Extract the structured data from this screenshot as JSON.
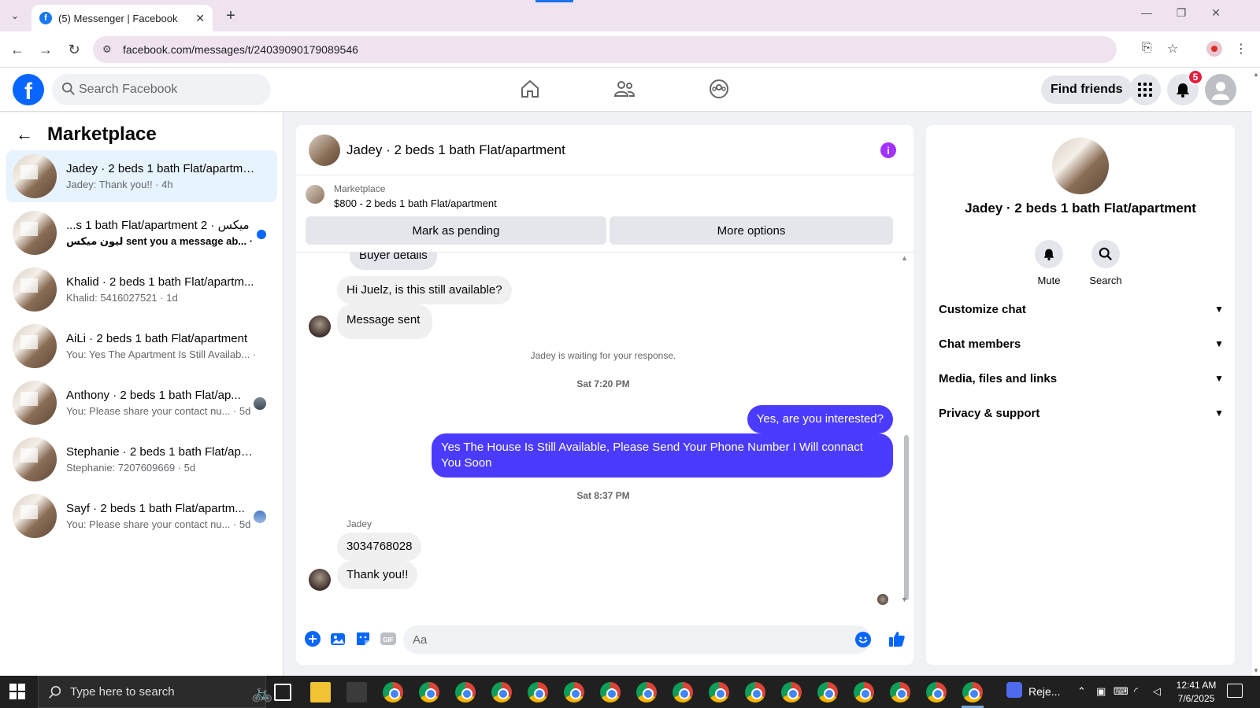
{
  "browser": {
    "tab_title": "(5) Messenger | Facebook",
    "tab_favicon": "f",
    "url": "facebook.com/messages/t/24039090179089546",
    "new_tab_symbol": "+",
    "close_tab_symbol": "✕"
  },
  "fb_header": {
    "logo_letter": "f",
    "search_placeholder": "Search Facebook",
    "find_friends_label": "Find friends",
    "notification_count": "5"
  },
  "sidebar": {
    "title": "Marketplace",
    "conversations": [
      {
        "name": "Jadey · 2 beds 1 bath Flat/apartment",
        "preview": "Jadey: Thank you!! · 4h",
        "active": true,
        "unread": false
      },
      {
        "name": "ميكس · 2 beds 1 bath Flat/apartment",
        "name_display": "...s 1 bath Flat/apartment 2 · ميكس",
        "preview": "ليون ميكس sent you a message ab... · 4h",
        "active": false,
        "unread": true
      },
      {
        "name": "Khalid · 2 beds 1 bath Flat/apartm...",
        "preview": "Khalid: 5416027521 · 1d",
        "active": false,
        "unread": false
      },
      {
        "name": "AiLi · 2 beds 1 bath Flat/apartment",
        "preview": "You: Yes The Apartment Is Still Availab... · 4d",
        "active": false,
        "unread": false
      },
      {
        "name": "Anthony · 2 beds 1 bath Flat/ap...",
        "preview": "You: Please share your contact nu... · 5d",
        "active": false,
        "unread": false
      },
      {
        "name": "Stephanie · 2 beds 1 bath Flat/apar...",
        "preview": "Stephanie: 7207609669 · 5d",
        "active": false,
        "unread": false
      },
      {
        "name": "Sayf · 2 beds 1 bath Flat/apartm...",
        "preview": "You: Please share your contact nu... · 5d",
        "active": false,
        "unread": false
      }
    ]
  },
  "chat": {
    "title": "Jadey · 2 beds 1 bath Flat/apartment",
    "marketplace_label": "Marketplace",
    "listing": "$800 - 2 beds 1 bath Flat/apartment",
    "mark_pending_label": "Mark as pending",
    "more_options_label": "More options",
    "partial_top": "Buyer details",
    "messages": {
      "m1": "Hi Juelz, is this still available?",
      "m2": "Message sent",
      "waiting": "Jadey is waiting for your response.",
      "time1": "Sat 7:20 PM",
      "m3": "Yes, are you interested?",
      "m4": "Yes The House Is Still Available, Please Send Your Phone Number I Will connact You Soon",
      "time2": "Sat 8:37 PM",
      "sender": "Jadey",
      "m5": "3034768028",
      "m6": "Thank you!!"
    },
    "composer_placeholder": "Aa",
    "accent_color": "#4b3bff"
  },
  "right_panel": {
    "name": "Jadey · 2 beds 1 bath Flat/apartment",
    "mute_label": "Mute",
    "search_label": "Search",
    "sections": [
      "Customize chat",
      "Chat members",
      "Media, files and links",
      "Privacy & support"
    ]
  },
  "taskbar": {
    "search_placeholder": "Type here to search",
    "zoom_label": "Reje...",
    "time": "12:41 AM",
    "date": "7/6/2025"
  }
}
